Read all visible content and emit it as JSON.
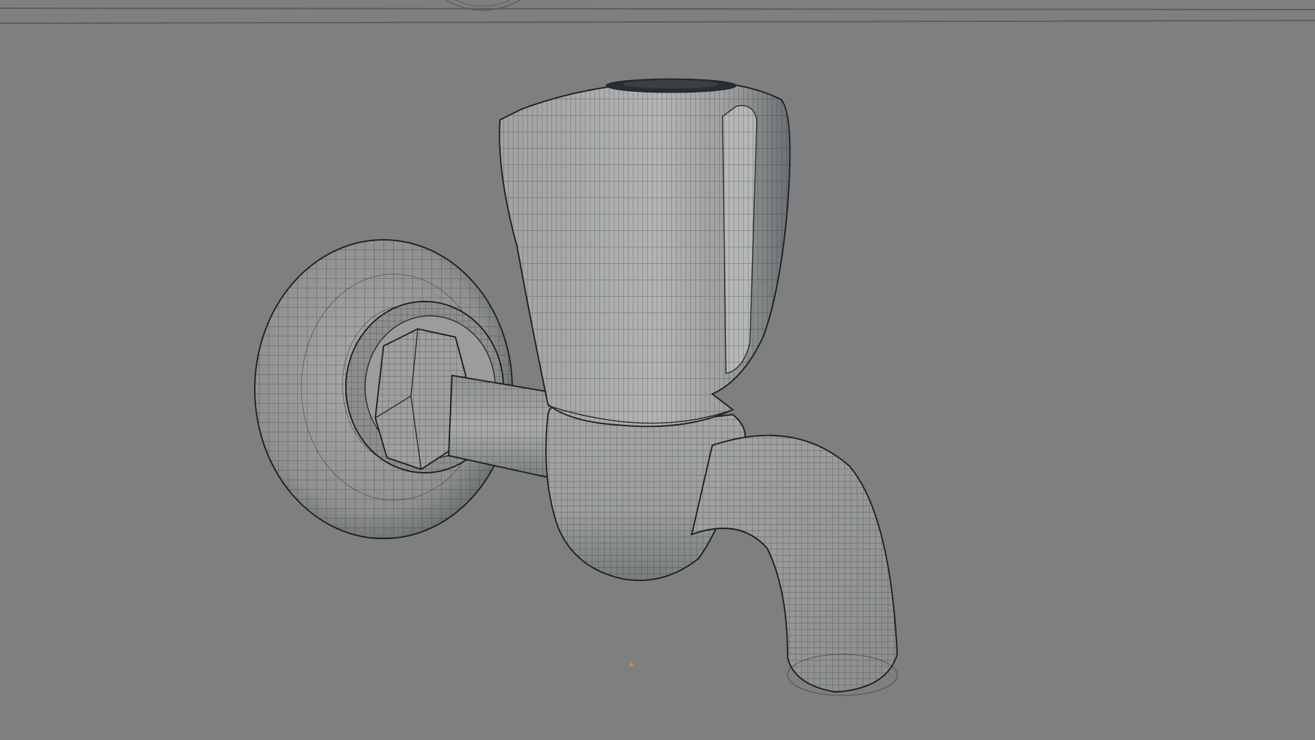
{
  "viewport": {
    "background_color": "#7d7f80",
    "wire_color": "#26292b",
    "mesh_light": "#a7a9aa",
    "mesh_mid": "#8f9192",
    "mesh_dark": "#4a4d4f",
    "origin_color": "#f28c28"
  },
  "scene": {
    "object": "faucet-tap",
    "display_mode": "wireframe-on-shaded",
    "parts": [
      "wall-flange",
      "hex-nut",
      "inlet-pipe",
      "tap-handle",
      "spout-body",
      "spout"
    ]
  }
}
